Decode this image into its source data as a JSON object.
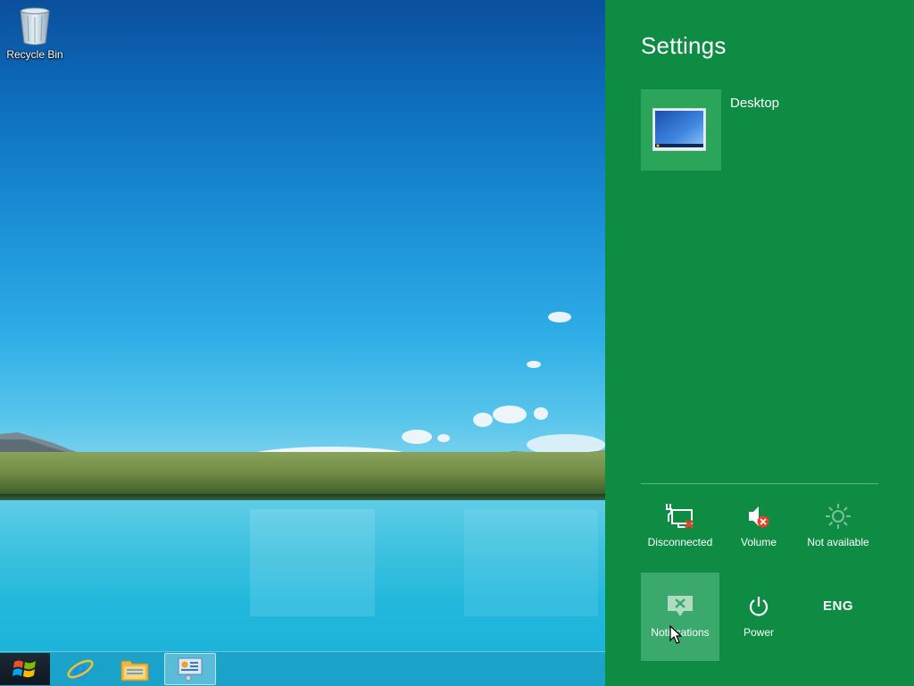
{
  "desktop": {
    "icons": [
      {
        "name": "recycle-bin",
        "label": "Recycle Bin"
      }
    ]
  },
  "taskbar": {
    "buttons": [
      {
        "name": "start",
        "icon": "windows-logo-icon"
      },
      {
        "name": "internet-explorer",
        "icon": "ie-icon"
      },
      {
        "name": "file-explorer",
        "icon": "folder-icon"
      },
      {
        "name": "control-panel",
        "icon": "control-panel-icon",
        "active": true
      }
    ]
  },
  "settings": {
    "title": "Settings",
    "context_tile": {
      "label": "Desktop",
      "icon": "monitor-icon"
    },
    "quick": {
      "network": {
        "label": "Disconnected",
        "icon": "network-disconnected-icon"
      },
      "volume": {
        "label": "Volume",
        "icon": "volume-muted-icon"
      },
      "brightness": {
        "label": "Not available",
        "icon": "brightness-icon"
      },
      "notifications": {
        "label": "Notifications",
        "icon": "notifications-off-icon"
      },
      "power": {
        "label": "Power",
        "icon": "power-icon"
      },
      "keyboard": {
        "label": "ENG"
      }
    }
  },
  "colors": {
    "charm_bg": "#0f8c43",
    "tile_bg": "#2aa55a",
    "hover_bg": "#3aa96b"
  }
}
